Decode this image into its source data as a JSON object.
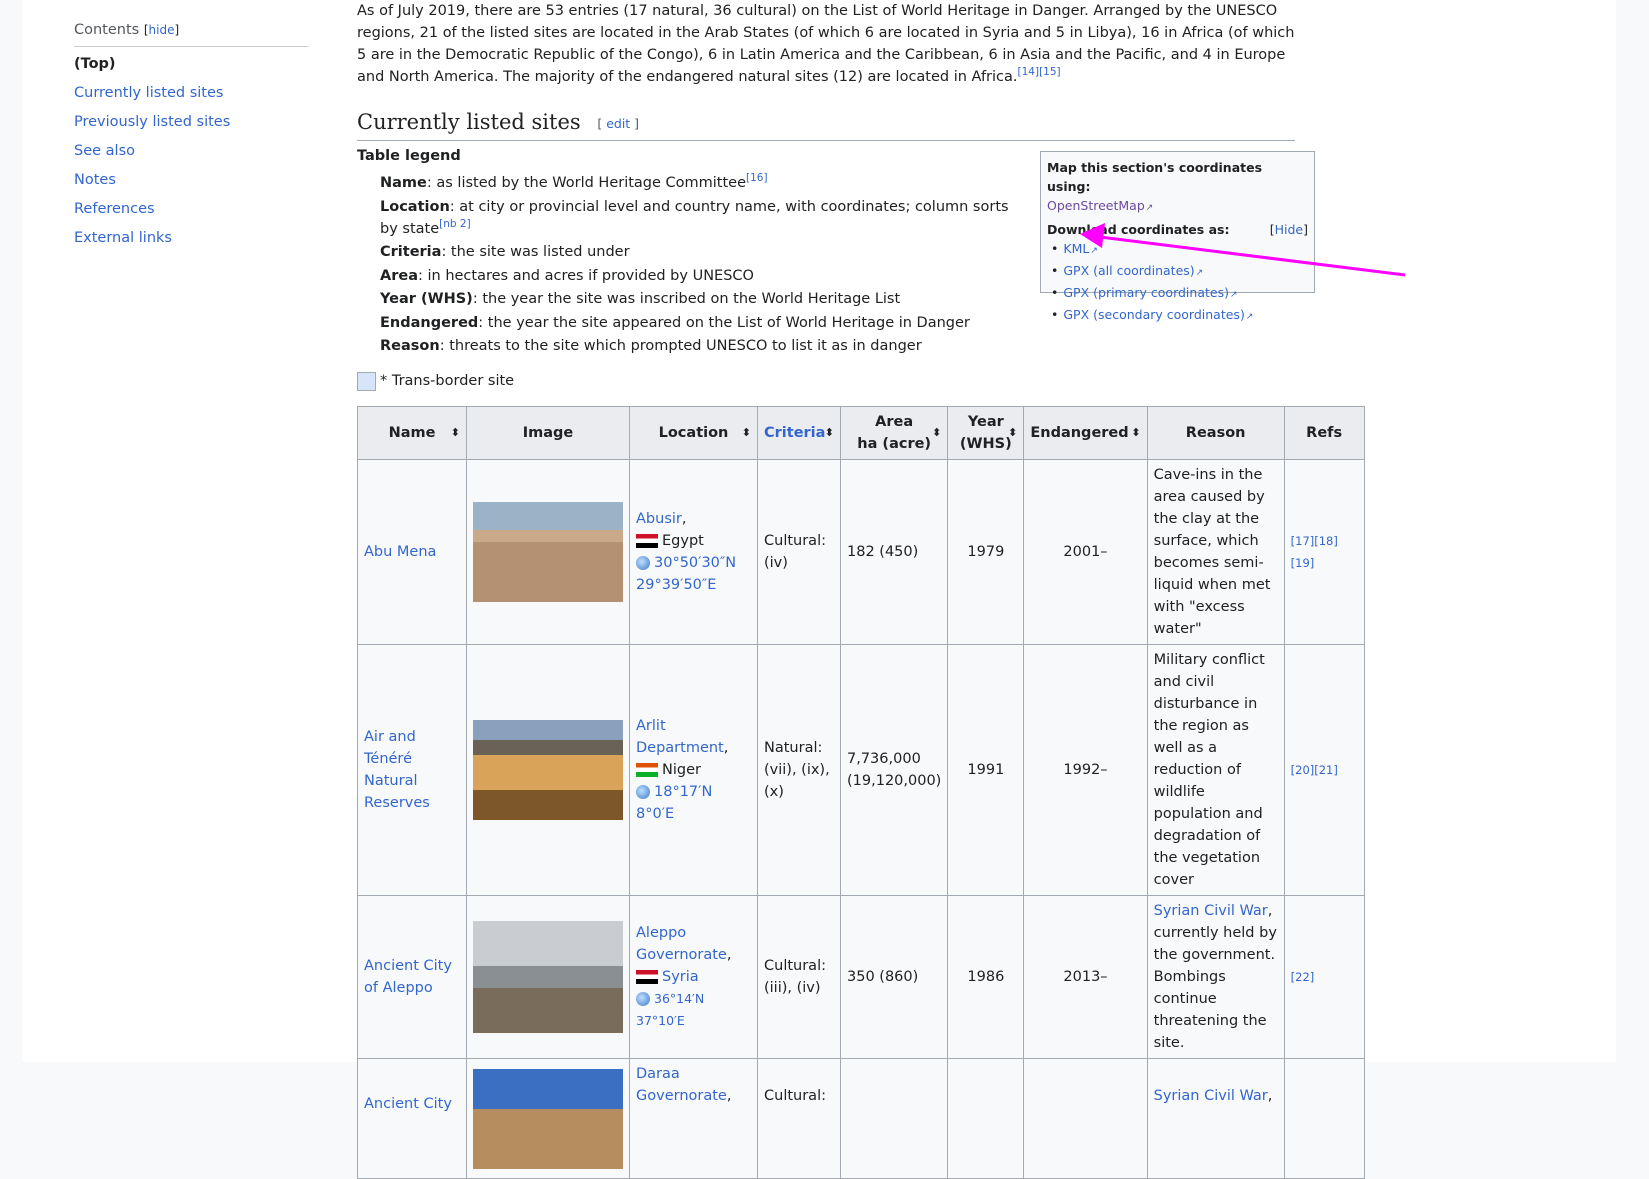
{
  "toc": {
    "title": "Contents",
    "hide_label": "hide",
    "items": [
      "(Top)",
      "Currently listed sites",
      "Previously listed sites",
      "See also",
      "Notes",
      "References",
      "External links"
    ]
  },
  "intro": {
    "text": "As of July 2019, there are 53 entries (17 natural, 36 cultural) on the List of World Heritage in Danger. Arranged by the UNESCO regions, 21 of the listed sites are located in the Arab States (of which 6 are located in Syria and 5 in Libya), 16 in Africa (of which 5 are in the Democratic Republic of the Congo), 6 in Latin America and the Caribbean, 6 in Asia and the Pacific, and 4 in Europe and North America. The majority of the endangered natural sites (12) are located in Africa.",
    "refs": "[14][15]"
  },
  "section": {
    "title": "Currently listed sites",
    "edit_label": "edit"
  },
  "legend": {
    "title": "Table legend",
    "items": [
      {
        "term": "Name",
        "desc": ": as listed by the World Heritage Committee",
        "ref": "[16]"
      },
      {
        "term": "Location",
        "desc": ": at city or provincial level and country name, with coordinates; column sorts by state",
        "ref": "[nb 2]"
      },
      {
        "term": "Criteria",
        "desc": ": the site was listed under",
        "ref": ""
      },
      {
        "term": "Area",
        "desc": ": in hectares and acres if provided by UNESCO",
        "ref": ""
      },
      {
        "term": "Year (WHS)",
        "desc": ": the year the site was inscribed on the World Heritage List",
        "ref": ""
      },
      {
        "term": "Endangered",
        "desc": ": the year the site appeared on the List of World Heritage in Danger",
        "ref": ""
      },
      {
        "term": "Reason",
        "desc": ": threats to the site which prompted UNESCO to list it as in danger",
        "ref": ""
      }
    ],
    "transborder": "* Trans-border site"
  },
  "coords": {
    "map_title": "Map this section's coordinates using:",
    "map_link": "OpenStreetMap",
    "download_title": "Download coordinates as:",
    "hide_label": "Hide",
    "links": [
      "KML",
      "GPX (all coordinates)",
      "GPX (primary coordinates)",
      "GPX (secondary coordinates)"
    ]
  },
  "table": {
    "headers": {
      "name": "Name",
      "image": "Image",
      "location": "Location",
      "criteria": "Criteria",
      "area_1": "Area",
      "area_2": "ha (acre)",
      "year_1": "Year",
      "year_2": "(WHS)",
      "endangered": "Endangered",
      "reason": "Reason",
      "refs": "Refs"
    },
    "rows": [
      {
        "name": "Abu Mena",
        "loc_place": "Abusir",
        "loc_country": "Egypt",
        "coord_1": "30°50′30″N",
        "coord_2": "29°39′50″E",
        "criteria_1": "Cultural:",
        "criteria_2": "(iv)",
        "area": "182 (450)",
        "year": "1979",
        "endangered": "2001–",
        "reason": "Cave-ins in the area caused by the clay at the surface, which becomes semi-liquid when met with \"excess water\"",
        "refs": "[17][18] [19]"
      },
      {
        "name": "Air and Ténéré Natural Reserves",
        "loc_place": "Arlit Department",
        "loc_country": "Niger",
        "coord_1": "18°17′N 8°0′E",
        "coord_2": "",
        "criteria_1": "Natural:",
        "criteria_2": "(vii), (ix), (x)",
        "area": "7,736,000 (19,120,000)",
        "year": "1991",
        "endangered": "1992–",
        "reason": "Military conflict and civil disturbance in the region as well as a reduction of wildlife population and degradation of the vegetation cover",
        "refs": "[20][21]"
      },
      {
        "name": "Ancient City of Aleppo",
        "loc_place": "Aleppo Governorate",
        "loc_country": "Syria",
        "coord_1": "36°14′N 37°10′E",
        "coord_2": "",
        "criteria_1": "Cultural:",
        "criteria_2": "(iii), (iv)",
        "area": "350 (860)",
        "year": "1986",
        "endangered": "2013–",
        "reason_link": "Syrian Civil War",
        "reason": ", currently held by the government. Bombings continue threatening the site.",
        "refs": "[22]"
      },
      {
        "name": "Ancient City",
        "loc_place": "Daraa Governorate",
        "criteria_1": "Cultural:",
        "reason_link": "Syrian Civil War"
      }
    ]
  },
  "colors": {
    "link": "#3366cc",
    "annotation_arrow": "#ff00ff"
  }
}
